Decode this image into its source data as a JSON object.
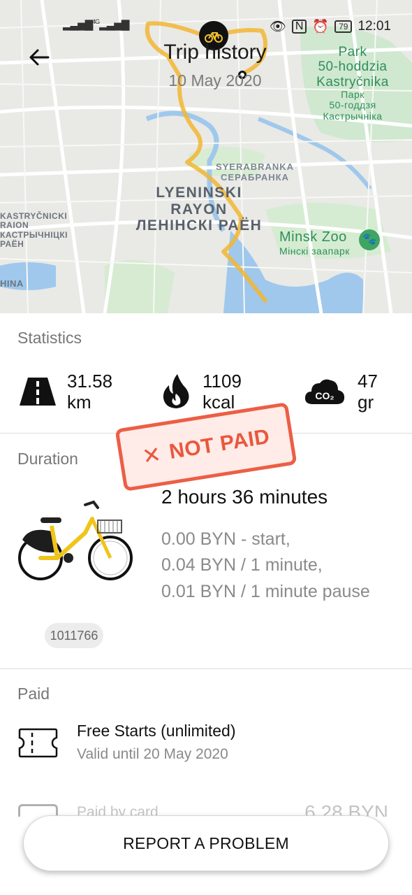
{
  "status_bar": {
    "network": "4G",
    "battery": "79",
    "time": "12:01"
  },
  "header": {
    "title": "Trip history",
    "date": "10 May 2020"
  },
  "map": {
    "district": [
      "LYENINSKI",
      "RAYON",
      "ЛЕНІНСКІ РАЁН"
    ],
    "neighborhood": [
      "SYERABRANKA",
      "СЕРАБРАНКА"
    ],
    "west_district": [
      "KASTRYČNICKI",
      "RAION",
      "КАСТРЫЧНІЦКІ",
      "РАЁН"
    ],
    "west_partial": "HINA",
    "park": [
      "Park",
      "50-hoddzia",
      "Kastryčnika",
      "Парк",
      "50-годдзя",
      "Кастрычніка"
    ],
    "zoo": [
      "Minsk Zoo",
      "Мінскі заапарк"
    ],
    "route_color": "#f2b632"
  },
  "statistics": {
    "title": "Statistics",
    "distance": {
      "value": "31.58",
      "unit": "km",
      "icon": "road-icon"
    },
    "calories": {
      "value": "1109",
      "unit": "kcal",
      "icon": "flame-icon"
    },
    "co2": {
      "value": "47",
      "unit": "gr",
      "icon": "co2-cloud-icon",
      "icon_text": "CO₂"
    }
  },
  "stamp": {
    "text": "NOT PAID",
    "color": "#ec5e45"
  },
  "duration": {
    "title": "Duration",
    "total": "2 hours 36 minutes",
    "rates": [
      "0.00 BYN - start,",
      "0.04 BYN / 1 minute,",
      "0.01 BYN / 1 minute pause"
    ],
    "bike_id": "1011766"
  },
  "paid": {
    "title": "Paid",
    "items": [
      {
        "title": "Free Starts (unlimited)",
        "subtitle": "Valid until 20 May 2020"
      }
    ],
    "partial_row": {
      "label": "Paid by card",
      "amount": "6.28 BYN"
    }
  },
  "report_button": "REPORT A PROBLEM"
}
